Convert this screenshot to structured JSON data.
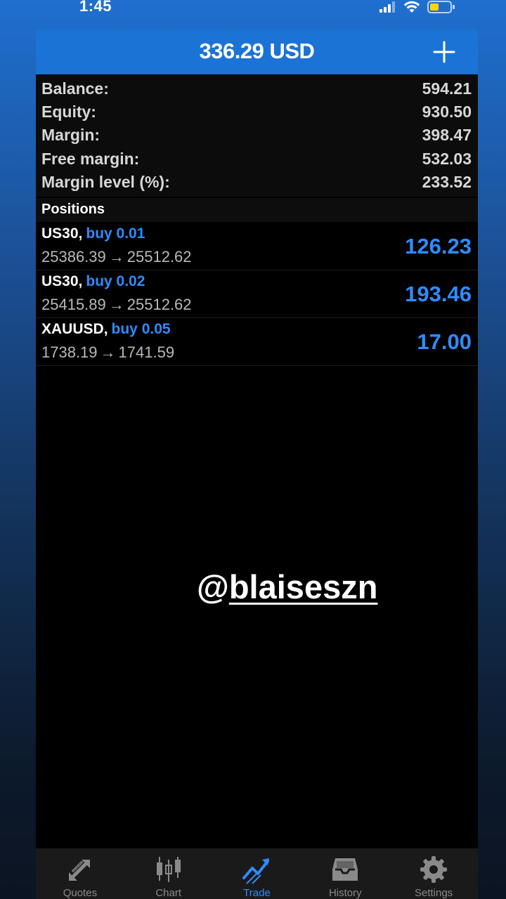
{
  "status_bar": {
    "time": "1:45"
  },
  "header": {
    "title": "336.29 USD"
  },
  "summary": [
    {
      "label": "Balance:",
      "value": "594.21"
    },
    {
      "label": "Equity:",
      "value": "930.50"
    },
    {
      "label": "Margin:",
      "value": "398.47"
    },
    {
      "label": "Free margin:",
      "value": "532.03"
    },
    {
      "label": "Margin level (%):",
      "value": "233.52"
    }
  ],
  "positions_title": "Positions",
  "positions": [
    {
      "symbol": "US30",
      "type": "buy 0.01",
      "open_price": "25386.39",
      "current_price": "25512.62",
      "profit": "126.23"
    },
    {
      "symbol": "US30",
      "type": "buy 0.02",
      "open_price": "25415.89",
      "current_price": "25512.62",
      "profit": "193.46"
    },
    {
      "symbol": "XAUUSD",
      "type": "buy 0.05",
      "open_price": "1738.19",
      "current_price": "1741.59",
      "profit": "17.00"
    }
  ],
  "arrow": "→",
  "separator": ",",
  "watermark": {
    "at": "@",
    "handle": "blaiseszn"
  },
  "tabs": [
    {
      "label": "Quotes",
      "icon": "quotes-arrows-icon",
      "active": false
    },
    {
      "label": "Chart",
      "icon": "candlestick-icon",
      "active": false
    },
    {
      "label": "Trade",
      "icon": "trend-icon",
      "active": true
    },
    {
      "label": "History",
      "icon": "inbox-icon",
      "active": false
    },
    {
      "label": "Settings",
      "icon": "gear-icon",
      "active": false
    }
  ],
  "colors": {
    "header_blue": "#1b73d6",
    "accent_blue": "#2f8cff",
    "battery_yellow": "#ffd60a"
  }
}
